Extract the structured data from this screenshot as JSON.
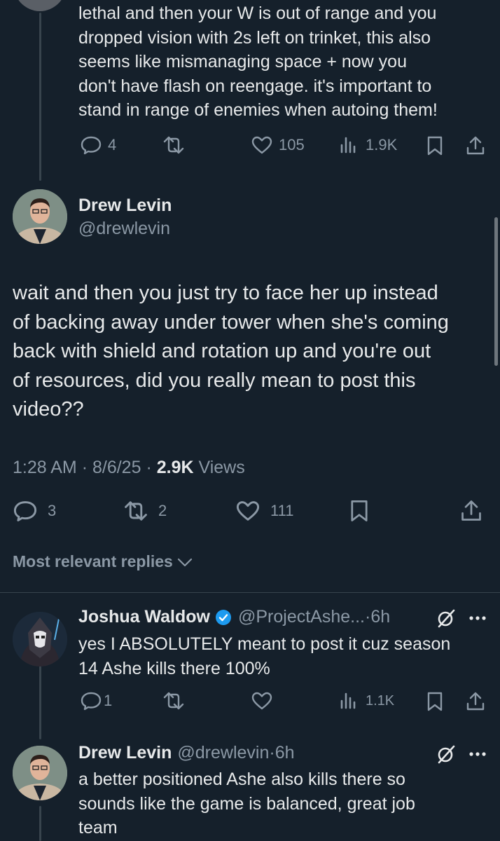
{
  "top_reply": {
    "text_lines": [
      "lethal and then your W is out of range and you",
      "dropped vision with 2s left on trinket, this also",
      "seems like mismanaging space + now you",
      "don't have flash on reengage. it's important to",
      "stand in range of enemies when autoing them!"
    ],
    "replies": "4",
    "likes": "105",
    "views": "1.9K"
  },
  "main_post": {
    "author_name": "Drew Levin",
    "author_handle": "@drewlevin",
    "text_lines": [
      "wait and then you just try to face her up instead",
      "of backing away under tower when she's coming",
      "back with shield and rotation up and you're out",
      "of resources, did you really mean to post this",
      "video??"
    ],
    "time": "1:28 AM",
    "date": "8/6/25",
    "views_count": "2.9K",
    "views_label": "Views",
    "replies": "3",
    "reposts": "2",
    "likes": "111"
  },
  "replies_section": {
    "label": "Most relevant replies"
  },
  "reply1": {
    "author_name": "Joshua Waldow",
    "author_handle": "@ProjectAshe...",
    "time": "6h",
    "text_lines": [
      "yes I ABSOLUTELY meant to post it cuz season",
      "14 Ashe kills there 100%"
    ],
    "replies": "1",
    "views": "1.1K"
  },
  "reply2": {
    "author_name": "Drew Levin",
    "author_handle": "@drewlevin",
    "time": "6h",
    "text_lines": [
      "a better positioned Ashe also kills there so",
      "sounds like the game is balanced, great job",
      "team"
    ]
  },
  "sep": "·",
  "colors": {
    "background": "#15202b",
    "text": "#e7e9ea",
    "secondary": "#8b98a5",
    "verified": "#1d9bf0"
  }
}
